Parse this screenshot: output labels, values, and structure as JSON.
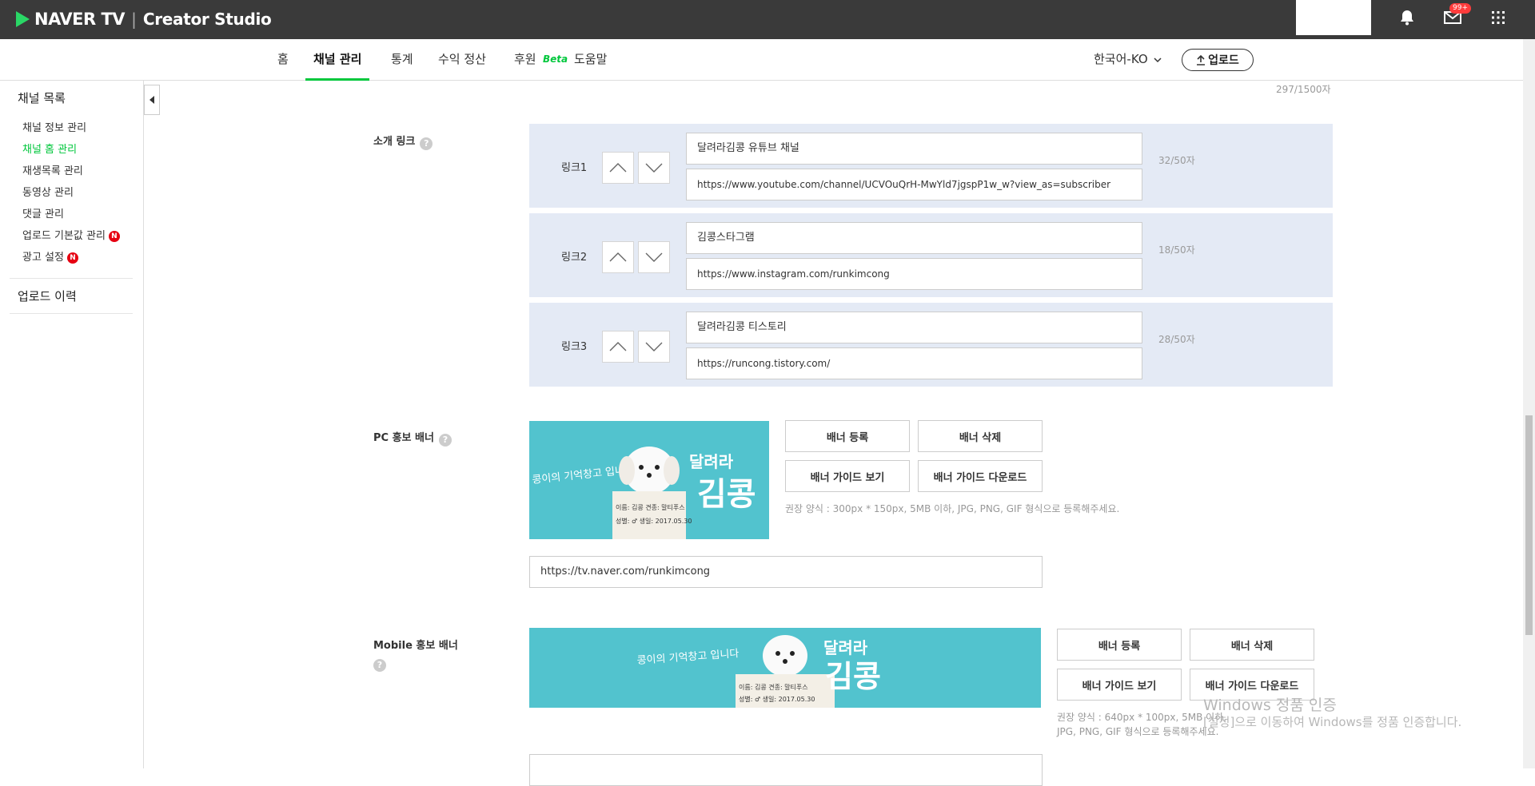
{
  "topbar": {
    "brand": "NAVER TV",
    "separator": "|",
    "studio": "Creator Studio",
    "mail_badge": "99+"
  },
  "nav": {
    "items": [
      "홈",
      "채널 관리",
      "통계",
      "수익 정산",
      "후원"
    ],
    "beta": "Beta",
    "help": "도움말",
    "language": "한국어-KO",
    "upload": "업로드"
  },
  "sidebar": {
    "channel_list": "채널 목록",
    "items": [
      {
        "label": "채널 정보 관리"
      },
      {
        "label": "채널 홈 관리"
      },
      {
        "label": "재생목록 관리"
      },
      {
        "label": "동영상 관리"
      },
      {
        "label": "댓글 관리"
      },
      {
        "label": "업로드 기본값 관리"
      },
      {
        "label": "광고 설정"
      }
    ],
    "new_badge": "N",
    "upload_history": "업로드 이력"
  },
  "main": {
    "top_char_count": "297/1500자",
    "intro_links": {
      "label": "소개 링크",
      "help": "?",
      "links": [
        {
          "label": "링크1",
          "title": "달려라김콩 유튜브 채널",
          "url": "https://www.youtube.com/channel/UCVOuQrH-MwYld7jgspP1w_w?view_as=subscriber",
          "count": "32/50자"
        },
        {
          "label": "링크2",
          "title": "김콩스타그램",
          "url": "https://www.instagram.com/runkimcong",
          "count": "18/50자"
        },
        {
          "label": "링크3",
          "title": "달려라김콩 티스토리",
          "url": "https://runcong.tistory.com/",
          "count": "28/50자"
        }
      ]
    },
    "pc_banner": {
      "label": "PC 홍보 배너",
      "register": "배너 등록",
      "delete": "배너 삭제",
      "guide_view": "배너 가이드 보기",
      "guide_download": "배너 가이드 다운로드",
      "note": "권장 양식 : 300px * 150px, 5MB 이하, JPG, PNG, GIF 형식으로 등록해주세요.",
      "url": "https://tv.naver.com/runkimcong"
    },
    "mobile_banner": {
      "label": "Mobile 홍보 배너",
      "register": "배너 등록",
      "delete": "배너 삭제",
      "guide_view": "배너 가이드 보기",
      "guide_download": "배너 가이드 다운로드",
      "note_line1": "권장 양식 : 640px * 100px, 5MB 이하,",
      "note_line2": "JPG, PNG, GIF 형식으로 등록해주세요."
    },
    "banner_art": {
      "caption": "콩이의 기억창고 입니다",
      "title_small": "달려라",
      "title_big": "김콩",
      "sign_line1": "이름: 김콩  견종: 말티푸스",
      "sign_line2": "성별: ♂  생일: 2017.05.30"
    }
  },
  "watermark": {
    "line1": "Windows 정품 인증",
    "line2": "[설정]으로 이동하여 Windows를 정품 인증합니다."
  }
}
